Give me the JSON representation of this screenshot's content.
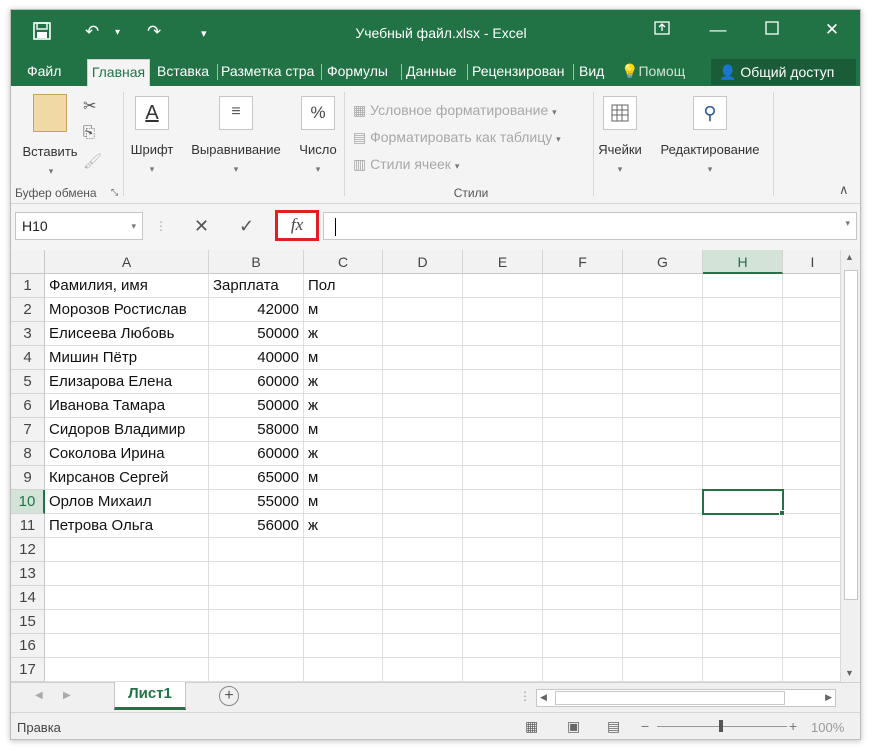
{
  "title": "Учебный файл.xlsx - Excel",
  "tabs": [
    "Файл",
    "Главная",
    "Вставка",
    "Разметка стра",
    "Формулы",
    "Данные",
    "Рецензирован",
    "Вид"
  ],
  "help_label": "Помощ",
  "share_label": "Общий доступ",
  "ribbon": {
    "paste": "Вставить",
    "clipboard_group": "Буфер обмена",
    "font": "Шрифт",
    "alignment": "Выравнивание",
    "number": "Число",
    "cond_format": "Условное форматирование",
    "format_table": "Форматировать как таблицу",
    "cell_styles": "Стили ячеек",
    "styles_group": "Стили",
    "cells": "Ячейки",
    "editing": "Редактирование"
  },
  "formula_bar": {
    "name_box": "H10",
    "fx_label": "fx",
    "value": ""
  },
  "columns": [
    "A",
    "B",
    "C",
    "D",
    "E",
    "F",
    "G",
    "H",
    "I"
  ],
  "rows": [
    [
      "Фамилия, имя",
      "Зарплата",
      "Пол"
    ],
    [
      "Морозов Ростислав",
      "42000",
      "м"
    ],
    [
      "Елисеева Любовь",
      "50000",
      "ж"
    ],
    [
      "Мишин Пётр",
      "40000",
      "м"
    ],
    [
      "Елизарова Елена",
      "60000",
      "ж"
    ],
    [
      "Иванова Тамара",
      "50000",
      "ж"
    ],
    [
      "Сидоров Владимир",
      "58000",
      "м"
    ],
    [
      "Соколова Ирина",
      "60000",
      "ж"
    ],
    [
      "Кирсанов Сергей",
      "65000",
      "м"
    ],
    [
      "Орлов Михаил",
      "55000",
      "м"
    ],
    [
      "Петрова Ольга",
      "56000",
      "ж"
    ],
    [
      "",
      "",
      ""
    ],
    [
      "",
      "",
      ""
    ],
    [
      "",
      "",
      ""
    ],
    [
      "",
      "",
      ""
    ],
    [
      "",
      "",
      ""
    ],
    [
      "",
      "",
      ""
    ]
  ],
  "row_numbers": [
    "1",
    "2",
    "3",
    "4",
    "5",
    "6",
    "7",
    "8",
    "9",
    "10",
    "11",
    "12",
    "13",
    "14",
    "15",
    "16",
    "17"
  ],
  "selected": {
    "column": "H",
    "row": "10"
  },
  "sheet_tab": "Лист1",
  "status": {
    "mode": "Правка",
    "zoom": "100%"
  },
  "colors": {
    "accent": "#217346",
    "highlight_border": "#e02020"
  }
}
